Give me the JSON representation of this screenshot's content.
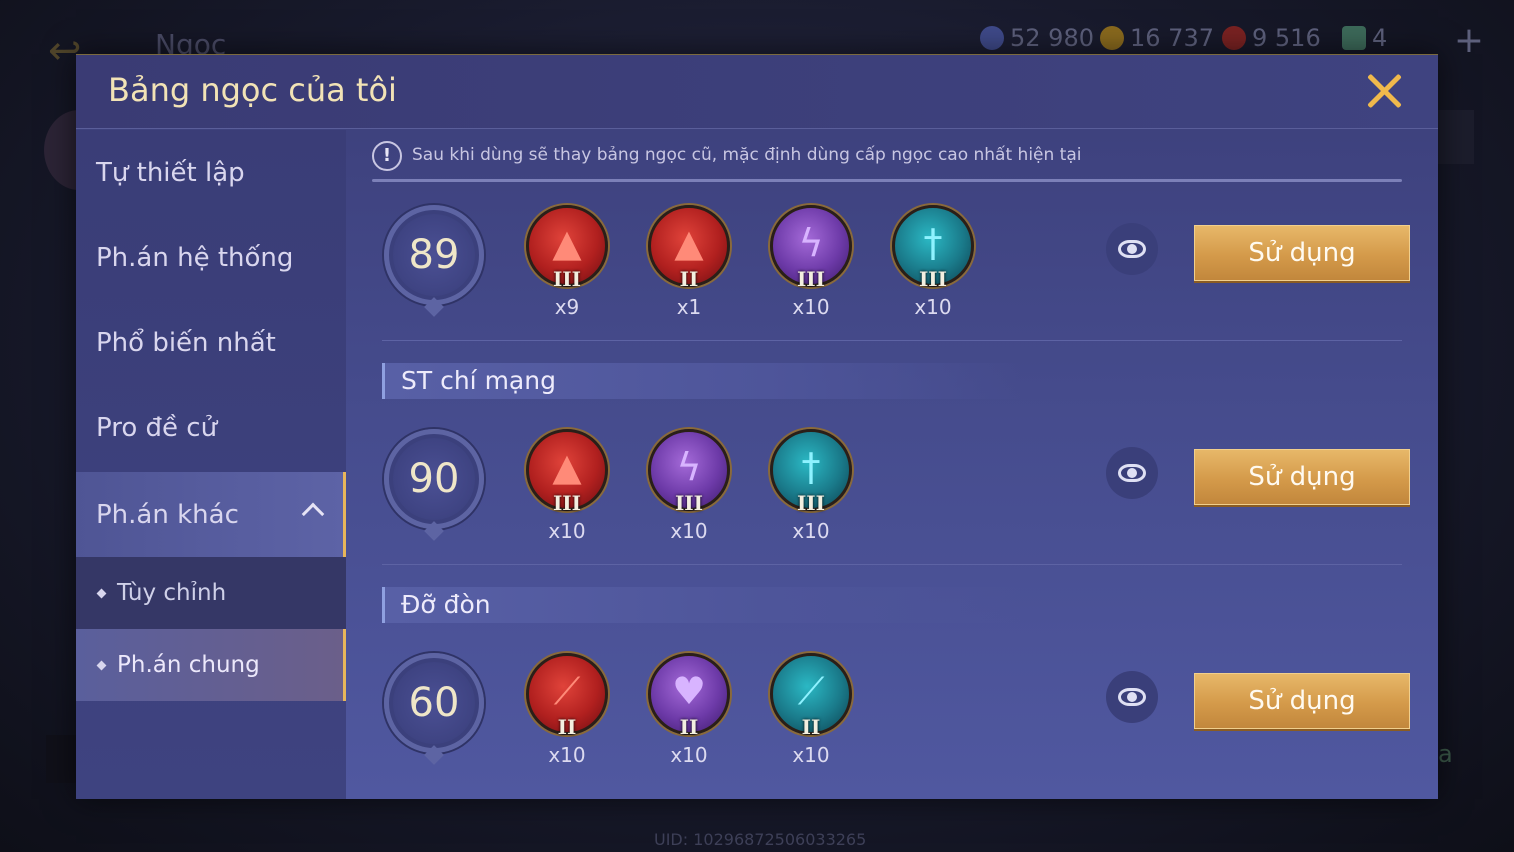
{
  "background": {
    "title": "Ngọc",
    "currencies": [
      {
        "icon": "diamond-icon",
        "value": "52 980",
        "color": "#3f4a8a"
      },
      {
        "icon": "gold-coin-icon",
        "value": "16 737",
        "color": "#8a6a1e"
      },
      {
        "icon": "ruby-icon",
        "value": "9 516",
        "color": "#7a2222"
      },
      {
        "icon": "voucher-icon",
        "value": "4",
        "color": "#3d6a5a"
      }
    ],
    "uid": "UID: 10296872506033265",
    "right_text": "a"
  },
  "modal": {
    "title": "Bảng ngọc của tôi"
  },
  "sidebar": {
    "items": [
      {
        "label": "Tự thiết lập"
      },
      {
        "label": "Ph.án hệ thống"
      },
      {
        "label": "Phổ biến nhất"
      },
      {
        "label": "Pro đề cử"
      },
      {
        "label": "Ph.án khác"
      }
    ],
    "subitems": [
      {
        "label": "Tùy chỉnh"
      },
      {
        "label": "Ph.án chung"
      }
    ]
  },
  "notice": {
    "icon": "!",
    "text": "Sau khi dùng sẽ thay bảng ngọc cũ, mặc định dùng cấp ngọc cao nhất hiện tại"
  },
  "sections": [
    {
      "label": "ST chí mạng"
    },
    {
      "label": "Đỡ đòn"
    }
  ],
  "rows": [
    {
      "level": "89",
      "use_label": "Sử dụng",
      "gems": [
        {
          "color": "red",
          "icon": "red-flame-icon",
          "glyph": "▲",
          "tier": "III",
          "count": "x9"
        },
        {
          "color": "red",
          "icon": "red-flame-icon",
          "glyph": "▲",
          "tier": "II",
          "count": "x1"
        },
        {
          "color": "purple",
          "icon": "purple-lightning-icon",
          "glyph": "ϟ",
          "tier": "III",
          "count": "x10"
        },
        {
          "color": "teal",
          "icon": "teal-sword-icon",
          "glyph": "†",
          "tier": "III",
          "count": "x10"
        }
      ]
    },
    {
      "level": "90",
      "use_label": "Sử dụng",
      "gems": [
        {
          "color": "red",
          "icon": "red-flame-icon",
          "glyph": "▲",
          "tier": "III",
          "count": "x10"
        },
        {
          "color": "purple",
          "icon": "purple-lightning-icon",
          "glyph": "ϟ",
          "tier": "III",
          "count": "x10"
        },
        {
          "color": "teal",
          "icon": "teal-sword-icon",
          "glyph": "†",
          "tier": "III",
          "count": "x10"
        }
      ]
    },
    {
      "level": "60",
      "use_label": "Sử dụng",
      "gems": [
        {
          "color": "red",
          "icon": "red-blade-icon",
          "glyph": "⟋",
          "tier": "II",
          "count": "x10"
        },
        {
          "color": "purple",
          "icon": "purple-heart-icon",
          "glyph": "♥",
          "tier": "II",
          "count": "x10"
        },
        {
          "color": "teal",
          "icon": "teal-blade-icon",
          "glyph": "⟋",
          "tier": "II",
          "count": "x10"
        }
      ]
    }
  ]
}
